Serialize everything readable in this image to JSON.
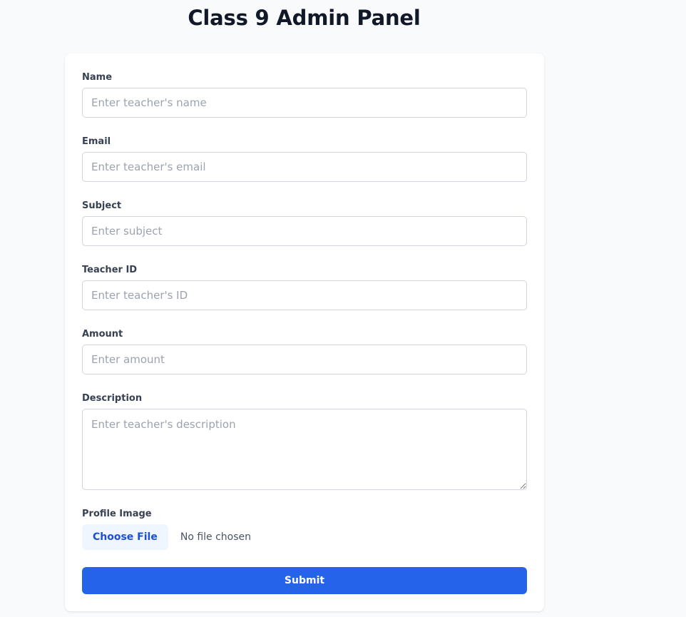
{
  "page": {
    "title": "Class 9 Admin Panel"
  },
  "form": {
    "name": {
      "label": "Name",
      "placeholder": "Enter teacher's name",
      "value": ""
    },
    "email": {
      "label": "Email",
      "placeholder": "Enter teacher's email",
      "value": ""
    },
    "subject": {
      "label": "Subject",
      "placeholder": "Enter subject",
      "value": ""
    },
    "teacher_id": {
      "label": "Teacher ID",
      "placeholder": "Enter teacher's ID",
      "value": ""
    },
    "amount": {
      "label": "Amount",
      "placeholder": "Enter amount",
      "value": ""
    },
    "description": {
      "label": "Description",
      "placeholder": "Enter teacher's description",
      "value": ""
    },
    "profile_image": {
      "label": "Profile Image",
      "button_label": "Choose File",
      "status": "No file chosen"
    },
    "submit_label": "Submit"
  },
  "colors": {
    "background": "#f8fafc",
    "card": "#ffffff",
    "primary": "#2563eb",
    "file_button_bg": "#eff6ff",
    "file_button_text": "#1d4ed8",
    "border": "#d1d5db"
  }
}
